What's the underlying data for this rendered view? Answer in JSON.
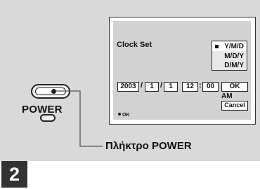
{
  "power": {
    "label": "POWER"
  },
  "callout": {
    "label": "Πλήκτρο POWER"
  },
  "lcd": {
    "title": "Clock Set",
    "formats": [
      "Y/M/D",
      "M/D/Y",
      "D/M/Y"
    ],
    "year": "2003",
    "month": "1",
    "day": "1",
    "hour": "12",
    "minute": "00",
    "separator_date": "/",
    "separator_time": ":",
    "ok_button": "OK",
    "ampm": "AM",
    "cancel_button": "Cancel",
    "ok_hint": "OK"
  },
  "step": {
    "number": "2"
  }
}
